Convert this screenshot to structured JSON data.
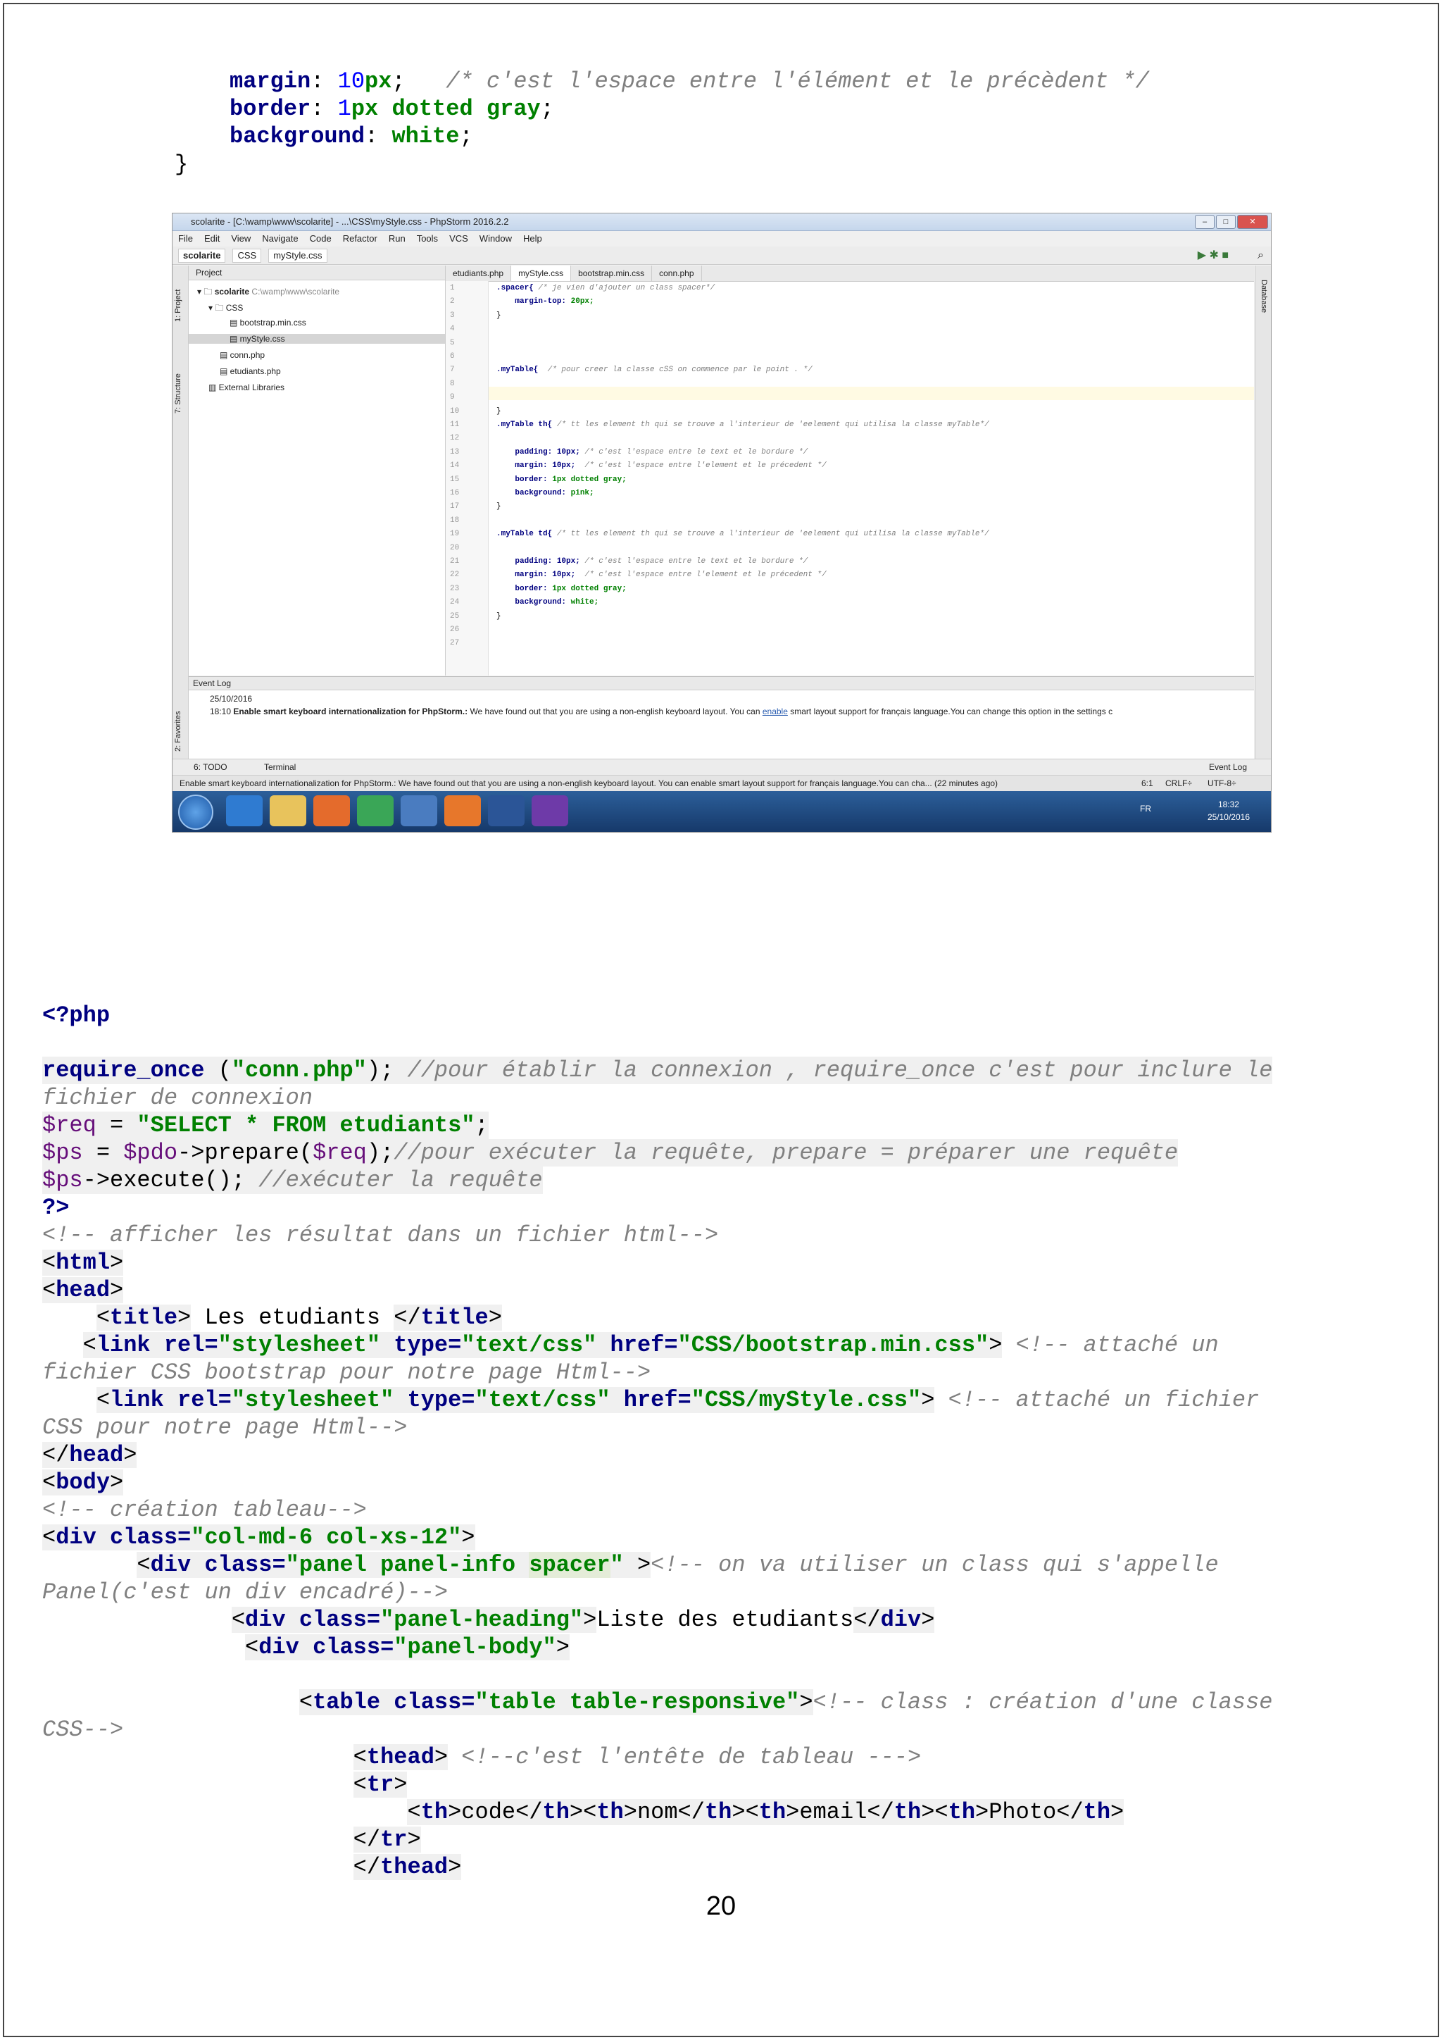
{
  "top_code": {
    "line1": {
      "prop": "margin",
      "num": "10",
      "unit": "px",
      "comment": "/* c'est l'espace entre l'élément et le précèdent */"
    },
    "line2": {
      "prop": "border",
      "num": "1",
      "value": "px dotted gray"
    },
    "line3": {
      "prop": "background",
      "value": "white"
    },
    "close_brace": "}"
  },
  "ide": {
    "title": "scolarite - [C:\\wamp\\www\\scolarite] - ...\\CSS\\myStyle.css - PhpStorm 2016.2.2",
    "menu": [
      "File",
      "Edit",
      "View",
      "Navigate",
      "Code",
      "Refactor",
      "Run",
      "Tools",
      "VCS",
      "Window",
      "Help"
    ],
    "breadcrumbs": [
      "scolarite",
      "CSS",
      "myStyle.css"
    ],
    "left_strip": [
      "1: Project",
      "7: Structure",
      "2: Favorites"
    ],
    "right_strip": "Database",
    "project_header": "Project",
    "tree": {
      "root": "scolarite",
      "root_path": "C:\\wamp\\www\\scolarite",
      "css_folder": "CSS",
      "bootstrap": "bootstrap.min.css",
      "mystyle": "myStyle.css",
      "conn": "conn.php",
      "etudiants": "etudiants.php",
      "external": "External Libraries"
    },
    "tabs": [
      "etudiants.php",
      "myStyle.css",
      "bootstrap.min.css",
      "conn.php"
    ],
    "editor_lines": [
      ".spacer{ /* je vien d'ajouter un class spacer*/",
      "    margin-top: 20px;",
      "}",
      "",
      "",
      "",
      ".myTable{  /* pour creer la classe cSS on commence par le point . */",
      "",
      "",
      "}",
      ".myTable th{ /* tt les element th qui se trouve a l'interieur de 'eelement qui utilisa la classe myTable*/",
      "",
      "    padding: 10px; /* c'est l'espace entre le text et le bordure */",
      "    margin: 10px;  /* c'est l'espace entre l'element et le précedent */",
      "    border: 1px dotted gray;",
      "    background: pink;",
      "}",
      "",
      ".myTable td{ /* tt les element th qui se trouve a l'interieur de 'eelement qui utilisa la classe myTable*/",
      "",
      "    padding: 10px; /* c'est l'espace entre le text et le bordure */",
      "    margin: 10px;  /* c'est l'espace entre l'element et le précedent */",
      "    border: 1px dotted gray;",
      "    background: white;",
      "}",
      "",
      ""
    ],
    "event_log_header": "Event Log",
    "event_date": "25/10/2016",
    "event_time": "18:10",
    "event_title": "Enable smart keyboard internationalization for PhpStorm.:",
    "event_text": "We have found out that you are using a non-english keyboard layout. You can",
    "event_link": "enable",
    "event_text2": "smart layout support for français language.You can change this option in the settings c",
    "bottom_todo": "6: TODO",
    "bottom_terminal": "Terminal",
    "bottom_eventlog": "Event Log",
    "status_text": "Enable smart keyboard internationalization for PhpStorm.: We have found out that you are using a non-english keyboard layout. You can enable smart layout support for français language.You can cha... (22 minutes ago)",
    "status_pos": "6:1",
    "status_crlf": "CRLF÷",
    "status_enc": "UTF-8÷",
    "tray_lang": "FR",
    "clock_time": "18:32",
    "clock_date": "25/10/2016"
  },
  "php": {
    "open": "<?php",
    "require_kw": "require_once",
    "require_arg": "\"conn.php\"",
    "require_comment_a": "//pour établir la connexion , require_once c'est pour inclure le",
    "require_comment_b": "fichier de connexion",
    "req_var": "$req",
    "req_str": "\"SELECT * FROM etudiants\"",
    "ps_var": "$ps",
    "pdo_var": "$pdo",
    "prepare_call": "->prepare(",
    "prepare_comment": "//pour exécuter la requête, prepare = préparer une requête",
    "execute_call": "->execute();",
    "execute_comment": "//exécuter la requête",
    "close": "?>",
    "html_comment": "<!-- afficher les résultat dans un fichier html-->",
    "title_text": " Les etudiants ",
    "link1_href": "\"CSS/bootstrap.min.css\"",
    "link1_comment_a": "<!-- attaché un",
    "link1_comment_b": "fichier CSS bootstrap pour notre page Html-->",
    "link2_href": "\"CSS/myStyle.css\"",
    "link2_comment_a": "<!-- attaché un fichier",
    "link2_comment_b": "CSS pour notre page Html-->",
    "tableau_comment": "<!-- création tableau-->",
    "div1_class": "\"col-md-6 col-xs-12\"",
    "div2_class_a": "\"panel panel-info ",
    "div2_class_spacer": "spacer",
    "div2_comment_a": "<!-- on va utiliser un class qui s'appelle",
    "div2_comment_b": "Panel(c'est un div encadré)-->",
    "heading_class": "\"panel-heading\"",
    "heading_text": "Liste des etudiants",
    "body_class": "\"panel-body\"",
    "table_class": "\"table table-responsive\"",
    "table_comment_a": "<!-- class : création d'une classe",
    "table_comment_b": "CSS-->",
    "thead_comment": "<!--c'est l'entête de tableau --->",
    "th_code": "code",
    "th_nom": "nom",
    "th_email": "email",
    "th_photo": "Photo"
  },
  "page_number": "20"
}
